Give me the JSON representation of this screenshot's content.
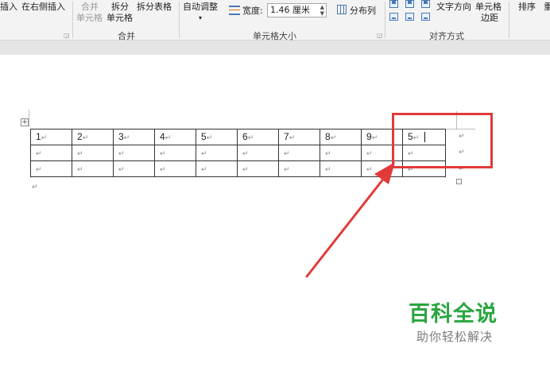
{
  "ribbon": {
    "insert_left_label": "插入",
    "insert_right_label": "在右侧插入",
    "merge_cells_top": "合并",
    "merge_cells_bottom": "单元格",
    "split_cells_top": "拆分",
    "split_cells_bottom": "单元格",
    "split_table_label": "拆分表格",
    "merge_group_label": "合并",
    "autofit_label": "自动调整",
    "width_label": "宽度:",
    "width_value": "1.46 厘米",
    "distribute_cols_label": "分布列",
    "cell_size_group_label": "单元格大小",
    "text_direction_label": "文字方向",
    "cell_margins_top": "单元格",
    "cell_margins_bottom": "边距",
    "alignment_group_label": "对齐方式",
    "sort_label": "排序",
    "repeat_label": "重"
  },
  "table": {
    "rows": [
      [
        "1",
        "2",
        "3",
        "4",
        "5",
        "6",
        "7",
        "8",
        "9",
        "5"
      ],
      [
        "",
        "",
        "",
        "",
        "",
        "",
        "",
        "",
        "",
        ""
      ],
      [
        "",
        "",
        "",
        "",
        "",
        "",
        "",
        "",
        "",
        ""
      ]
    ]
  },
  "watermark": {
    "title": "百科全说",
    "subtitle": "助你轻松解决"
  },
  "colors": {
    "annotation_red": "#e23a3a",
    "watermark_green": "#2aa53f",
    "ribbon_bg": "#f3f3f3"
  }
}
